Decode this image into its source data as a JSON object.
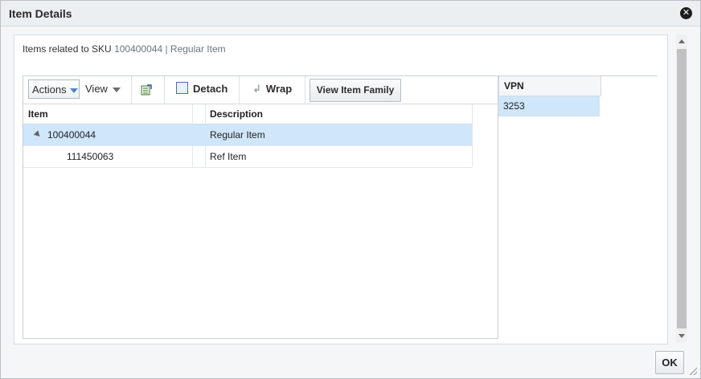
{
  "dialog": {
    "title": "Item Details",
    "close_icon": "close-icon"
  },
  "header": {
    "prefix": "Items related to SKU",
    "sku": "100400044 | Regular Item"
  },
  "toolbar": {
    "actions_label": "Actions",
    "view_label": "View",
    "export_icon": "export-to-excel-icon",
    "detach_label": "Detach",
    "wrap_label": "Wrap",
    "view_item_family_label": "View Item Family"
  },
  "table": {
    "columns": [
      "Item",
      "Description"
    ],
    "rows": [
      {
        "item": "100400044",
        "description": "Regular Item",
        "selected": true,
        "expandable": true
      },
      {
        "item": "111450063",
        "description": "Ref Item",
        "selected": false,
        "expandable": false
      }
    ]
  },
  "right_table": {
    "column": "VPN",
    "rows": [
      "3253"
    ]
  },
  "footer": {
    "ok_label": "OK"
  },
  "colors": {
    "selected_row": "#cfe6fb",
    "accent": "#4f86c6"
  }
}
